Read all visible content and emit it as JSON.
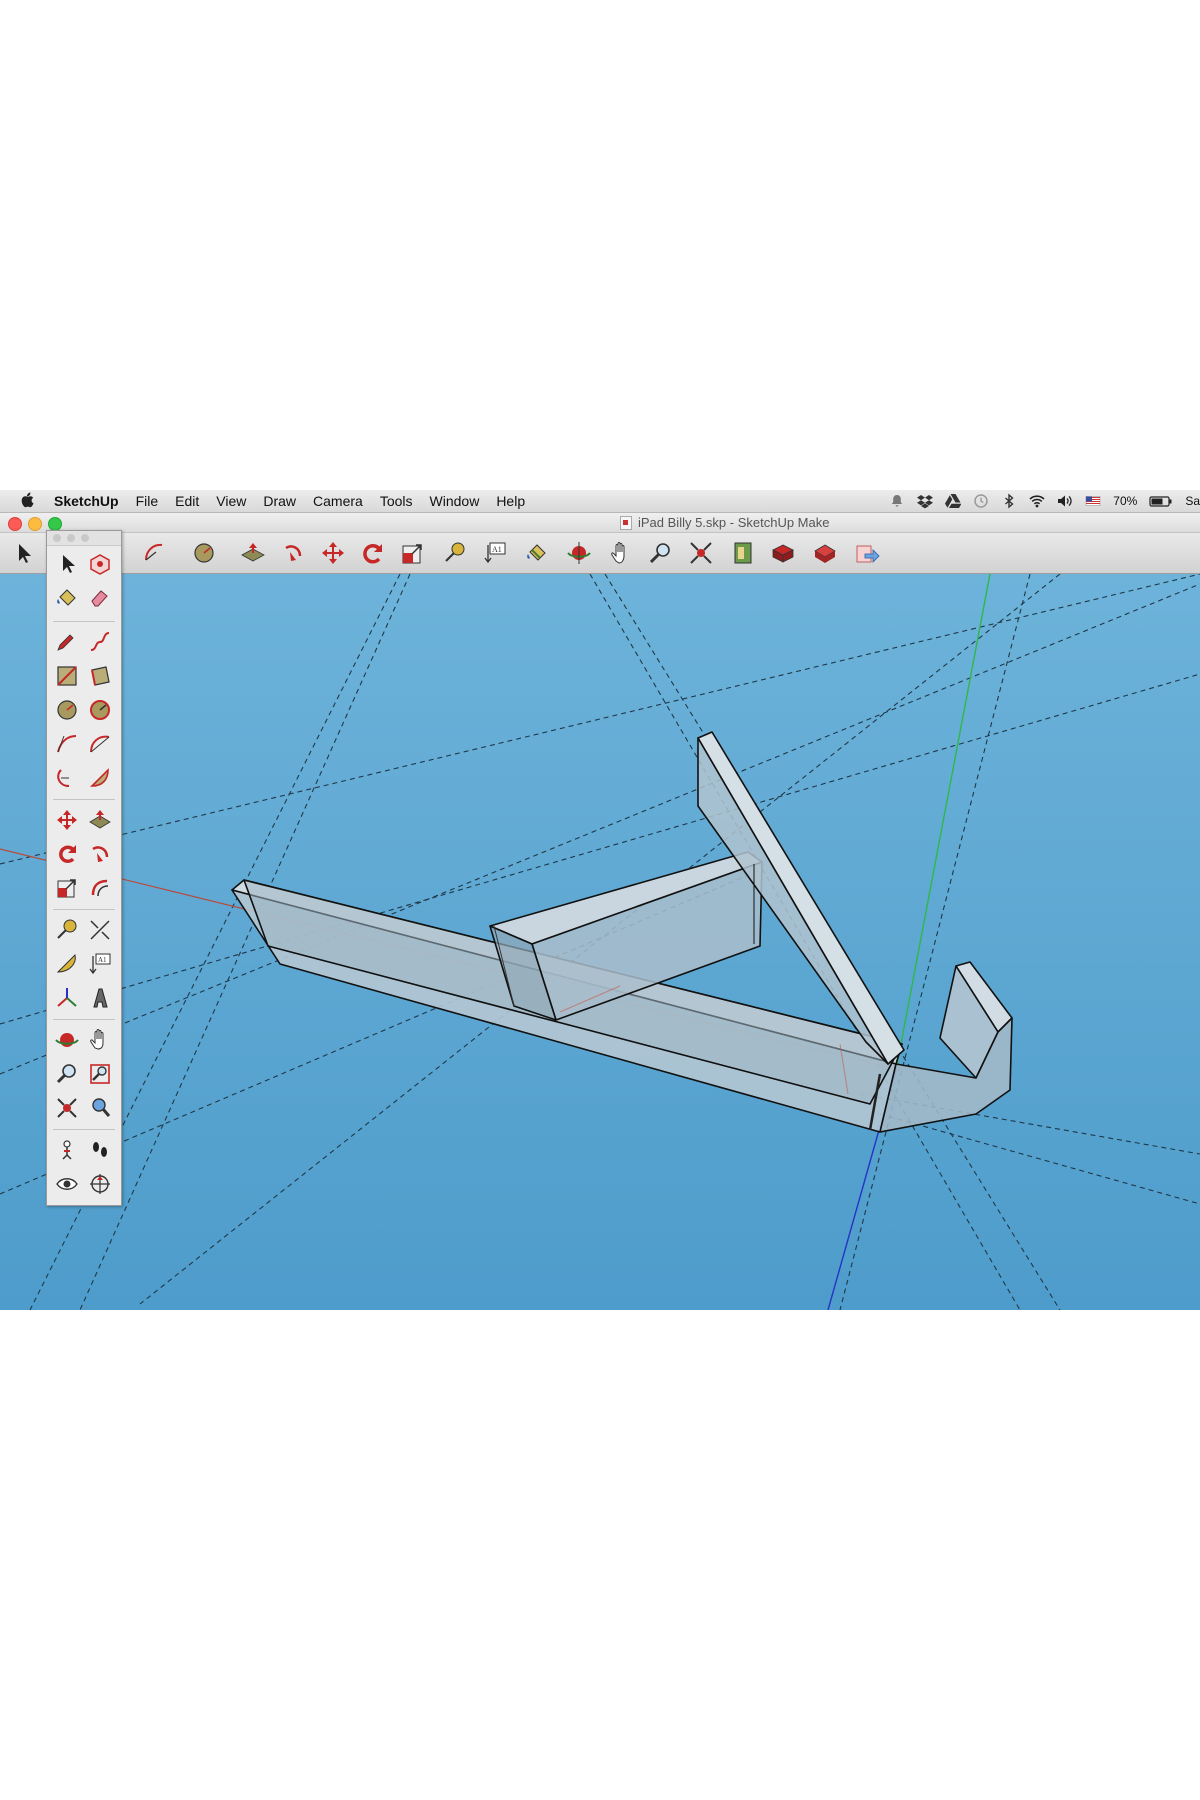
{
  "menubar": {
    "app_name": "SketchUp",
    "menus": [
      "File",
      "Edit",
      "View",
      "Draw",
      "Camera",
      "Tools",
      "Window",
      "Help"
    ],
    "battery_percent": "70%",
    "clock_partial": "Sa"
  },
  "window": {
    "title": "iPad Billy 5.skp - SketchUp Make"
  },
  "toolbar": {
    "tools": [
      "select-tool",
      "eraser-tool",
      "pencil-tool",
      "arc-tool",
      "circle-tool",
      "push-pull-tool",
      "follow-me-tool",
      "move-tool",
      "rotate-tool",
      "scale-tool",
      "tape-measure-tool",
      "text-tool",
      "paint-bucket-tool",
      "orbit-tool",
      "pan-tool",
      "zoom-tool",
      "zoom-extents-tool",
      "3d-warehouse-tool",
      "extension-warehouse-tool",
      "layout-tool",
      "send-to-layout-tool"
    ],
    "text_tool_glyph": "A1"
  },
  "palette": {
    "text_tool_glyph": "A1"
  },
  "colors": {
    "sky": "#5ba7d0",
    "axis_red": "#b84a3a",
    "axis_green": "#2fb84a",
    "axis_blue": "#2433c4",
    "model_fill": "#aebfcc",
    "accent_red": "#c62828"
  }
}
